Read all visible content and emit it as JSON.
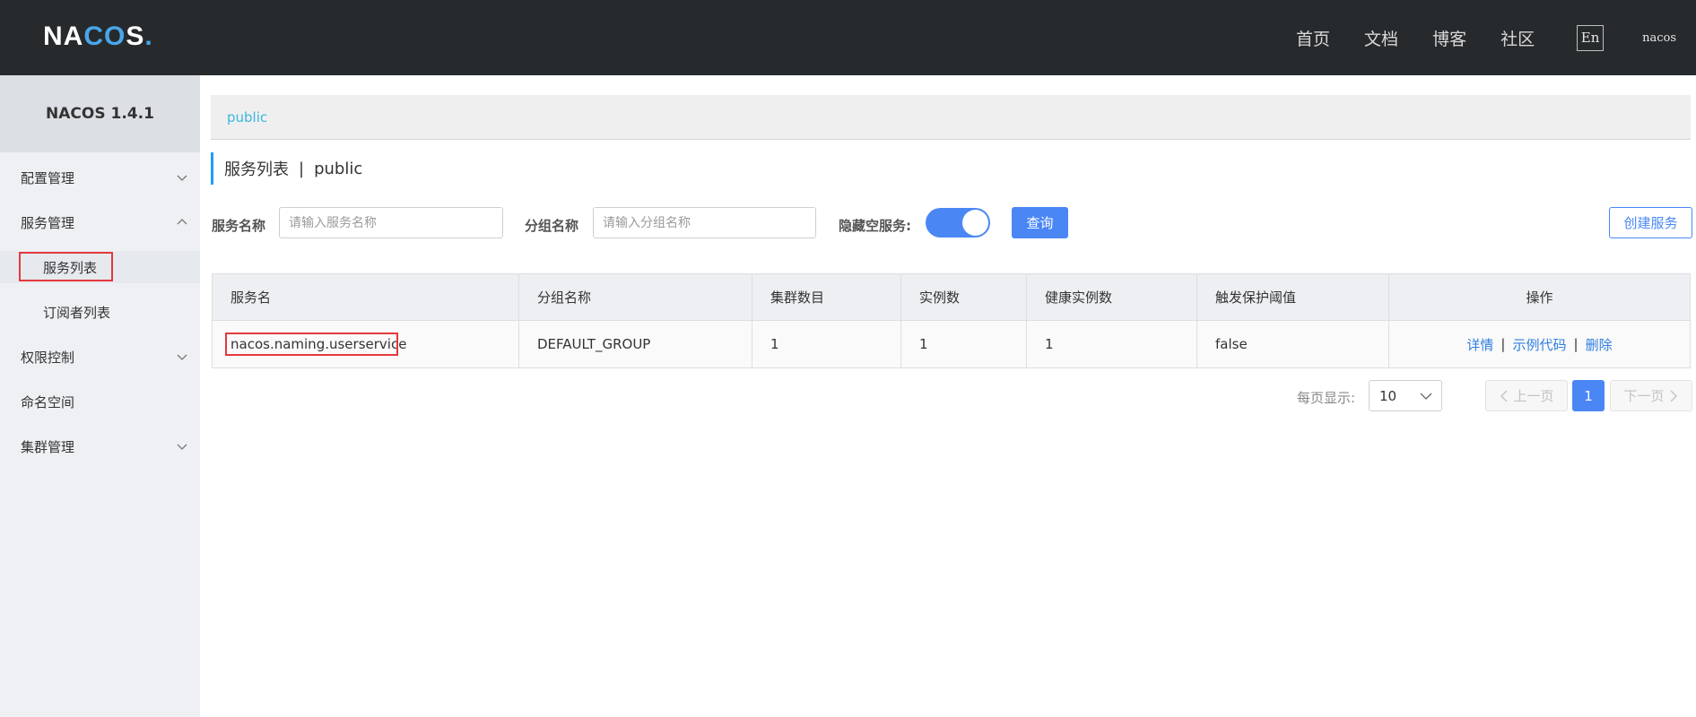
{
  "header": {
    "logo_main": "NA",
    "logo_accent": "CO",
    "logo_tail": "S",
    "logo_dot": ".",
    "nav": [
      "首页",
      "文档",
      "博客",
      "社区"
    ],
    "lang": "En",
    "user": "nacos"
  },
  "sidebar": {
    "title": "NACOS 1.4.1",
    "items": [
      {
        "label": "配置管理",
        "chevron": "down"
      },
      {
        "label": "服务管理",
        "chevron": "up"
      },
      {
        "label": "服务列表",
        "sub": true,
        "active": true
      },
      {
        "label": "订阅者列表",
        "sub": true
      },
      {
        "label": "权限控制",
        "chevron": "down"
      },
      {
        "label": "命名空间"
      },
      {
        "label": "集群管理",
        "chevron": "down"
      }
    ]
  },
  "namespace": {
    "current": "public"
  },
  "page": {
    "title": "服务列表",
    "separator": "|",
    "namespace": "public"
  },
  "filters": {
    "service_label": "服务名称",
    "service_placeholder": "请输入服务名称",
    "group_label": "分组名称",
    "group_placeholder": "请输入分组名称",
    "hide_empty_label": "隐藏空服务:",
    "hide_empty_on": true,
    "query_button": "查询",
    "create_button": "创建服务"
  },
  "table": {
    "columns": [
      "服务名",
      "分组名称",
      "集群数目",
      "实例数",
      "健康实例数",
      "触发保护阈值",
      "操作"
    ],
    "rows": [
      {
        "service": "nacos.naming.userservice",
        "group": "DEFAULT_GROUP",
        "clusters": "1",
        "instances": "1",
        "healthy": "1",
        "threshold": "false",
        "ops": [
          "详情",
          "示例代码",
          "删除"
        ]
      }
    ]
  },
  "pagination": {
    "page_size_label": "每页显示:",
    "page_size": "10",
    "prev": "上一页",
    "next": "下一页",
    "current": "1"
  },
  "colors": {
    "header_bg": "#262a2d",
    "primary": "#4a87f5",
    "link": "#2f7de1",
    "highlight_box": "#e4393c"
  }
}
